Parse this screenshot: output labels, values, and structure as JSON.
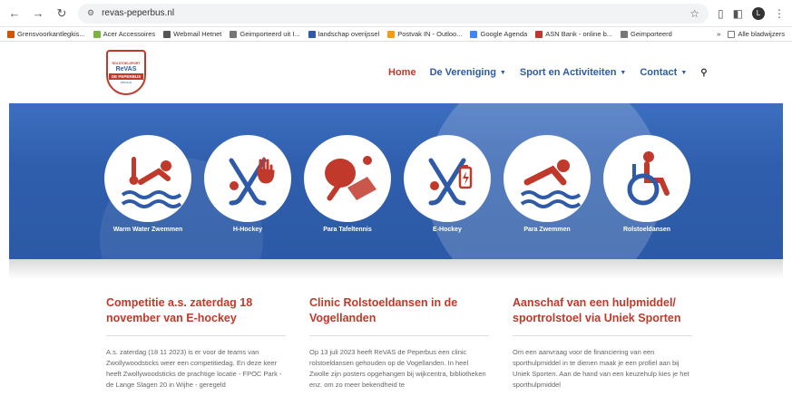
{
  "browser": {
    "url": "revas-peperbus.nl",
    "avatar_letter": "L"
  },
  "bookmarks": {
    "items": [
      {
        "label": "Grensvoorkantlegkis...",
        "color": "#d35400"
      },
      {
        "label": "Acer Accessoires",
        "color": "#7cb342"
      },
      {
        "label": "Webmail Hetnet",
        "color": "#555555"
      },
      {
        "label": "Geimporteerd uit I...",
        "color": "#777777"
      },
      {
        "label": "landschap overijssel",
        "color": "#2e5aa8"
      },
      {
        "label": "Postvak IN - Outloo...",
        "color": "#f39c12"
      },
      {
        "label": "Google Agenda",
        "color": "#4285f4"
      },
      {
        "label": "ASN Bank - online b...",
        "color": "#c0392b"
      },
      {
        "label": "Geimporteerd",
        "color": "#777777"
      }
    ],
    "overflow": "»",
    "all_label": "Alle bladwijzers"
  },
  "site": {
    "logo": {
      "top": "ROLSTOELSPORT",
      "name": "ReVAS",
      "band": "DE PEPERBUS",
      "sub": "ZWOLLE"
    },
    "nav": [
      {
        "label": "Home",
        "active": true,
        "caret": false
      },
      {
        "label": "De Vereniging",
        "active": false,
        "caret": true
      },
      {
        "label": "Sport en Activiteiten",
        "active": false,
        "caret": true
      },
      {
        "label": "Contact",
        "active": false,
        "caret": true
      }
    ]
  },
  "hero": {
    "items": [
      {
        "label": "Warm Water Zwemmen",
        "icon": "swimmer-thermometer-icon"
      },
      {
        "label": "H-Hockey",
        "icon": "hockey-hand-icon"
      },
      {
        "label": "Para Tafeltennis",
        "icon": "table-tennis-icon"
      },
      {
        "label": "E-Hockey",
        "icon": "hockey-battery-icon"
      },
      {
        "label": "Para Zwemmen",
        "icon": "swimmer-icon"
      },
      {
        "label": "Rolstoeldansen",
        "icon": "wheelchair-icon"
      }
    ]
  },
  "news": [
    {
      "title": "Competitie a.s. zaterdag 18 november van E-hockey",
      "text": "A.s. zaterdag (18 11 2023) is er voor de teams van Zwollywoodsticks weer een competitiedag. En deze keer heeft Zwollywoodsticks de prachtige locatie - FPOC Park - de Lange Slagen 20 in Wijhe - geregeld"
    },
    {
      "title": "Clinic Rolstoeldansen in de Vogellanden",
      "text": "Op 13 juli 2023 heeft ReVAS de Peperbus een clinic rolstoeldansen gehouden op de Vogellanden. In heel Zwolle zijn posters opgehangen bij wijkcentra, bibliotheken enz. om zo meer bekendheid te"
    },
    {
      "title": "Aanschaf van een hulpmiddel/ sportrolstoel via Uniek Sporten",
      "text": "Om een aanvraag voor de financiering van een sporthulpmiddel in te dienen maak je een profiel aan bij Uniek Sporten. Aan de hand van een keuzehulp kies je het sporthulpmiddel"
    }
  ],
  "colors": {
    "brand_red": "#c0392b",
    "brand_blue": "#2e5aa8",
    "hero_blue": "#2f5ead"
  }
}
